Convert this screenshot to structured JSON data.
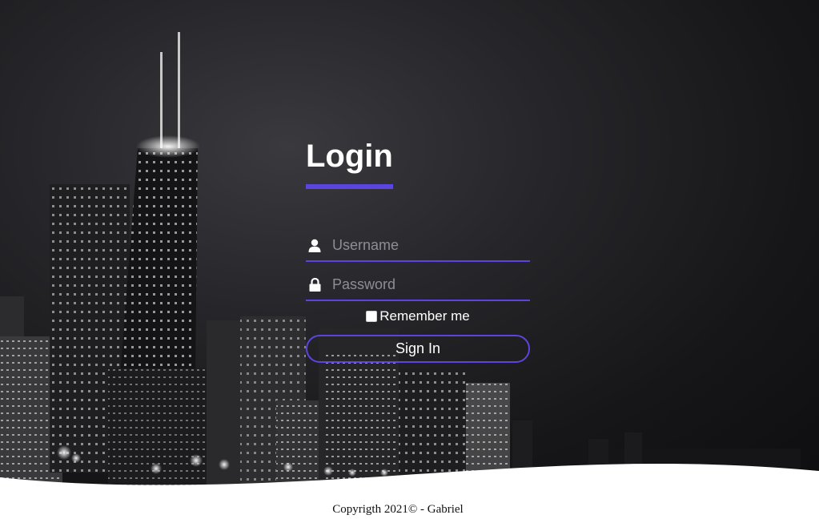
{
  "login": {
    "title": "Login",
    "username_placeholder": "Username",
    "password_placeholder": "Password",
    "remember_label": "Remember me",
    "remember_checked": false,
    "signin_label": "Sign In",
    "user_icon": "user-icon",
    "lock_icon": "lock-icon"
  },
  "footer": {
    "copyright": "Copyrigth 2021© - Gabriel"
  },
  "colors": {
    "accent": "#5b45e0",
    "background_dark": "#1a1a1d",
    "text_light": "#ffffff"
  }
}
